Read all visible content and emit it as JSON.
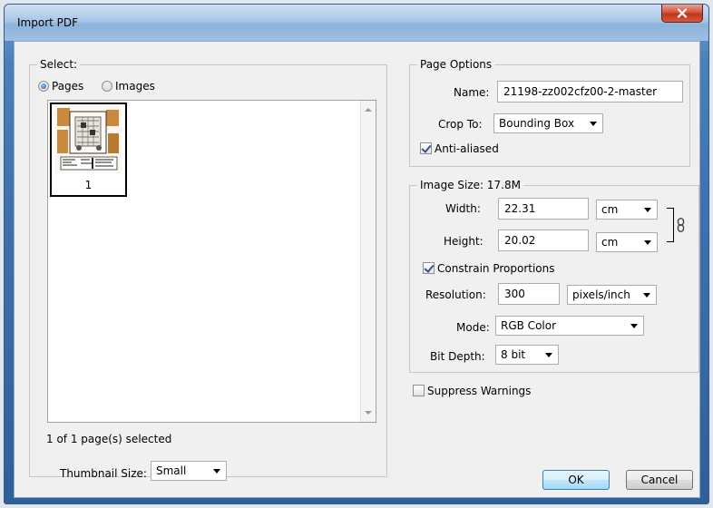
{
  "window": {
    "title": "Import PDF"
  },
  "select": {
    "legend": "Select:",
    "radio_pages": "Pages",
    "radio_images": "Images",
    "selected_option": "Pages",
    "thumbnail_page_number": "1",
    "status": "1 of 1 page(s) selected",
    "thumbnail_size_label": "Thumbnail Size:",
    "thumbnail_size_value": "Small"
  },
  "page_options": {
    "legend": "Page Options",
    "name_label": "Name:",
    "name_value": "21198-zz002cfz00-2-master",
    "crop_label": "Crop To:",
    "crop_value": "Bounding Box",
    "anti_aliased_label": "Anti-aliased",
    "anti_aliased_checked": true
  },
  "image_size": {
    "legend": "Image Size: 17.8M",
    "width_label": "Width:",
    "width_value": "22.31",
    "width_unit": "cm",
    "height_label": "Height:",
    "height_value": "20.02",
    "height_unit": "cm",
    "constrain_label": "Constrain Proportions",
    "constrain_checked": true,
    "resolution_label": "Resolution:",
    "resolution_value": "300",
    "resolution_unit": "pixels/inch",
    "mode_label": "Mode:",
    "mode_value": "RGB Color",
    "bit_depth_label": "Bit Depth:",
    "bit_depth_value": "8 bit"
  },
  "suppress_warnings": {
    "label": "Suppress Warnings",
    "checked": false
  },
  "buttons": {
    "ok": "OK",
    "cancel": "Cancel"
  },
  "icons": {
    "close": "close-icon",
    "link": "chain-link-icon"
  }
}
